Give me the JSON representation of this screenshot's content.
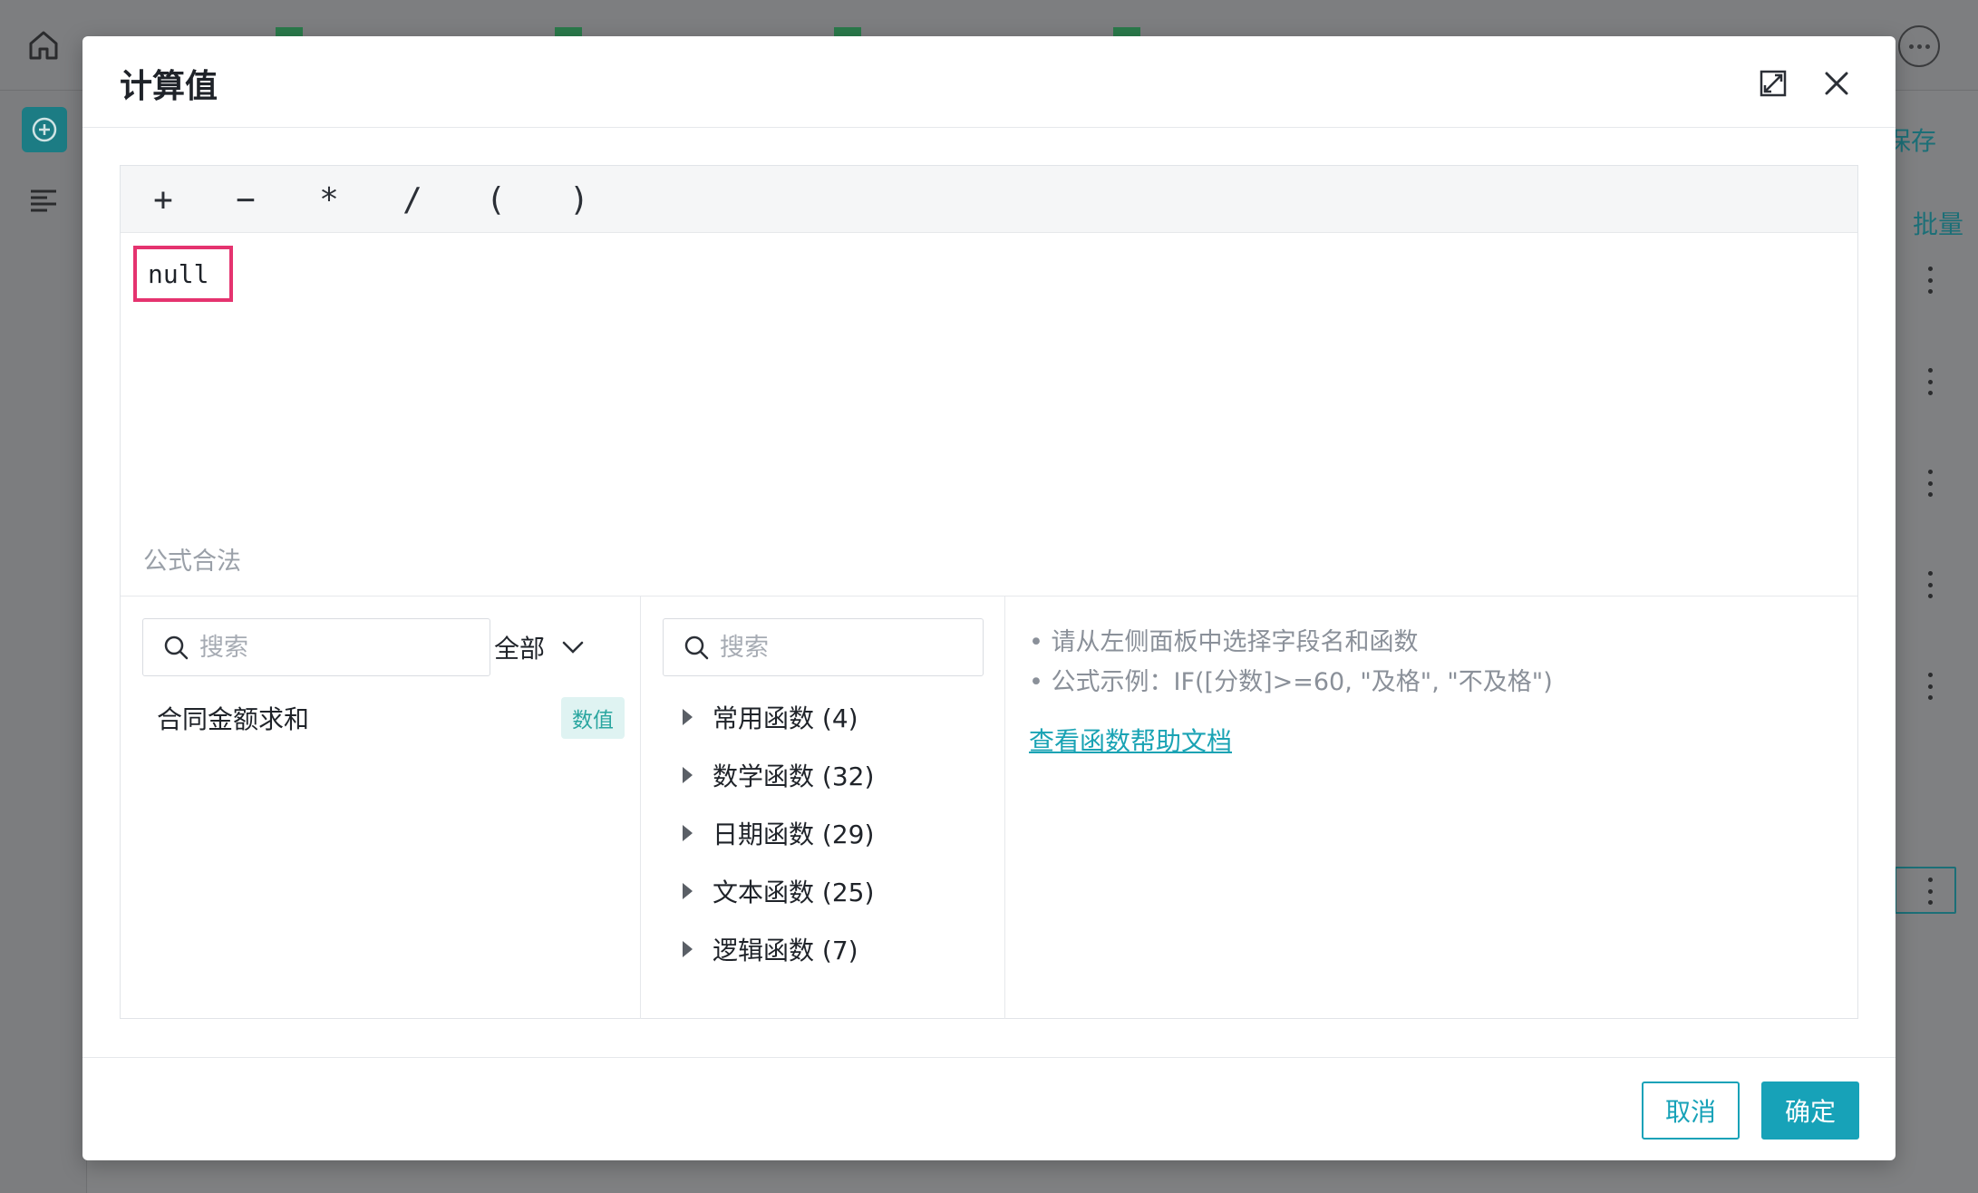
{
  "modal": {
    "title": "计算值",
    "operators": [
      "+",
      "−",
      "*",
      "/",
      "(",
      ")"
    ],
    "formula_token": "null",
    "formula_status": "公式合法",
    "fields_panel": {
      "search_placeholder": "搜索",
      "filter_label": "全部",
      "fields": [
        {
          "name": "合同金额求和",
          "type_badge": "数值"
        }
      ]
    },
    "functions_panel": {
      "search_placeholder": "搜索",
      "groups": [
        {
          "label": "常用函数 (4)"
        },
        {
          "label": "数学函数 (32)"
        },
        {
          "label": "日期函数 (29)"
        },
        {
          "label": "文本函数 (25)"
        },
        {
          "label": "逻辑函数 (7)"
        }
      ]
    },
    "help_panel": {
      "line1": "• 请从左侧面板中选择字段名和函数",
      "line2": "• 公式示例：IF([分数]>=60, \"及格\", \"不及格\")",
      "link": "查看函数帮助文档"
    },
    "footer": {
      "cancel_label": "取消",
      "ok_label": "确定"
    }
  },
  "background": {
    "save_label": "保存",
    "batch_label": "批量"
  },
  "colors": {
    "accent": "#17a2b8",
    "highlight_border": "#e5336f",
    "badge_bg": "#dff3f2"
  }
}
